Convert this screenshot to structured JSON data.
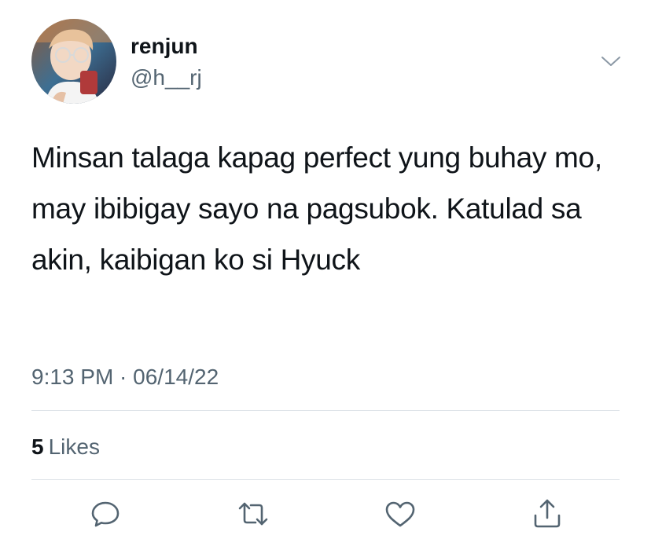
{
  "author": {
    "display_name": "renjun",
    "handle": "@h__rj",
    "avatar_icon": "profile-photo"
  },
  "tweet": {
    "text": "Minsan talaga kapag perfect yung buhay mo, may ibibigay sayo na pagsubok. Katulad sa akin, kaibigan ko si Hyuck",
    "timestamp": "9:13 PM · 06/14/22"
  },
  "stats": {
    "likes_count": "5",
    "likes_label": "Likes"
  },
  "actions": {
    "reply_icon": "reply-icon",
    "retweet_icon": "retweet-icon",
    "like_icon": "heart-icon",
    "share_icon": "share-icon"
  },
  "colors": {
    "text_primary": "#0f1419",
    "text_secondary": "#536471",
    "divider": "#dde3e8"
  }
}
